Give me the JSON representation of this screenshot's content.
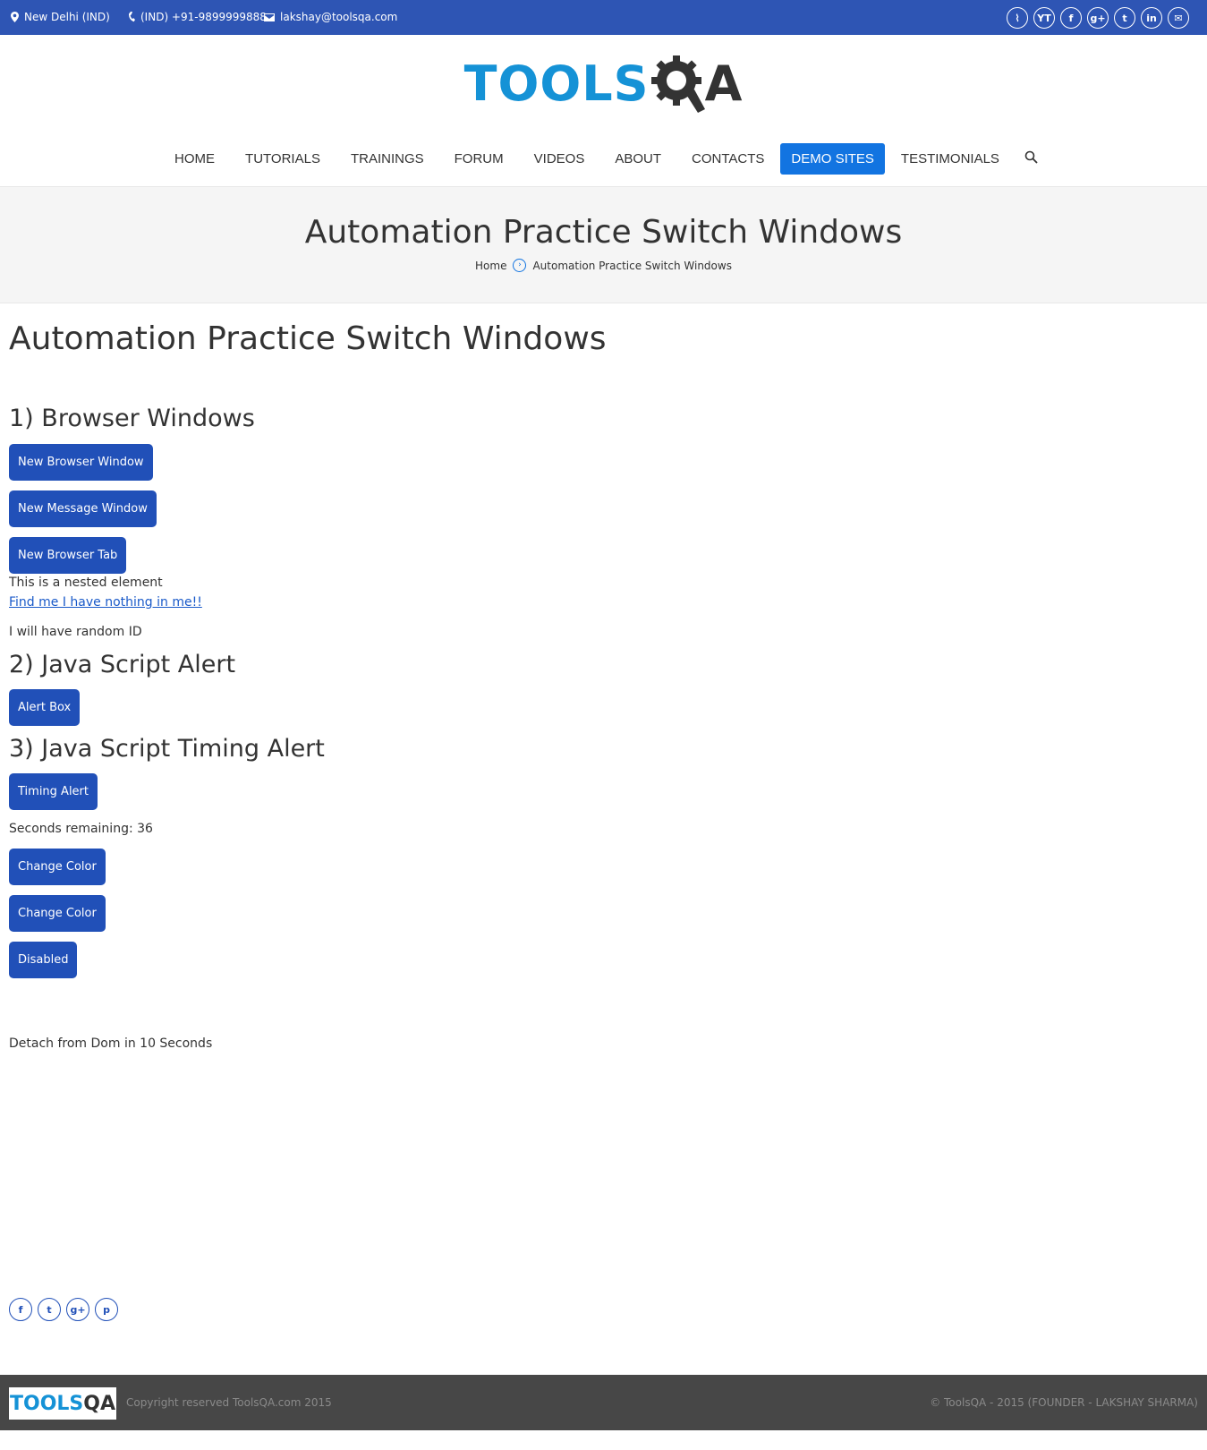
{
  "topbar": {
    "location": "New Delhi (IND)",
    "phone": "(IND) +91-9899999888",
    "email": "lakshay@toolsqa.com",
    "social": [
      {
        "icon": "rss-icon",
        "glyph": "⌇"
      },
      {
        "icon": "youtube-icon",
        "glyph": "YT"
      },
      {
        "icon": "facebook-icon",
        "glyph": "f"
      },
      {
        "icon": "google-plus-icon",
        "glyph": "g+"
      },
      {
        "icon": "twitter-icon",
        "glyph": "t"
      },
      {
        "icon": "linkedin-icon",
        "glyph": "in"
      },
      {
        "icon": "mail-icon",
        "glyph": "✉"
      }
    ]
  },
  "logo": {
    "part1": "TOOLS",
    "part2": "QA"
  },
  "nav": {
    "items": [
      "HOME",
      "TUTORIALS",
      "TRAININGS",
      "FORUM",
      "VIDEOS",
      "ABOUT",
      "CONTACTS",
      "DEMO SITES",
      "TESTIMONIALS"
    ],
    "active": "DEMO SITES"
  },
  "band": {
    "title": "Automation Practice Switch Windows",
    "breadcrumb_home": "Home",
    "breadcrumb_current": "Automation Practice Switch Windows"
  },
  "main": {
    "title": "Automation Practice Switch Windows",
    "section1": "1) Browser Windows",
    "btn_new_browser_window": "New Browser Window",
    "btn_new_message_window": "New Message Window",
    "btn_new_browser_tab": "New Browser Tab",
    "nested_text": "This is a nested element",
    "find_me_link": "Find me I have nothing in me!!",
    "random_id_text": "I will have random ID",
    "section2": "2) Java Script Alert",
    "btn_alert_box": "Alert Box",
    "section3": "3) Java Script Timing Alert",
    "btn_timing_alert": "Timing Alert",
    "seconds_remaining": "Seconds remaining: 36",
    "btn_change_color_1": "Change Color",
    "btn_change_color_2": "Change Color",
    "btn_disabled": "Disabled",
    "detach_text": "Detach from Dom in 10 Seconds"
  },
  "share": [
    {
      "icon": "facebook-icon",
      "glyph": "f"
    },
    {
      "icon": "twitter-icon",
      "glyph": "t"
    },
    {
      "icon": "google-plus-icon",
      "glyph": "g+"
    },
    {
      "icon": "pinterest-icon",
      "glyph": "p"
    }
  ],
  "footer": {
    "logo_part1": "TOOLS",
    "logo_part2": "QA",
    "copyright_left": "Copyright reserved ToolsQA.com 2015",
    "copyright_right": "© ToolsQA - 2015 (FOUNDER - LAKSHAY SHARMA)"
  },
  "colors": {
    "topbar": "#2e55b4",
    "accent": "#1274e1",
    "button": "#2150b8",
    "logo_blue": "#1592d6",
    "footer": "#474747"
  }
}
